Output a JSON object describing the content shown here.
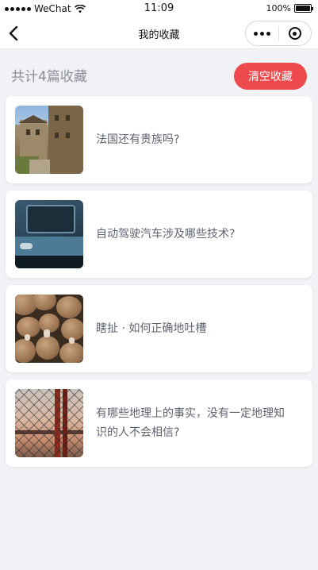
{
  "status_bar": {
    "carrier": "WeChat",
    "time": "11:09",
    "battery": "100%"
  },
  "nav": {
    "title": "我的收藏"
  },
  "header": {
    "count_text": "共计4篇收藏",
    "clear_button": "清空收藏"
  },
  "favorites": [
    {
      "title": "法国还有贵族吗?",
      "thumbnail": "street-houses-photo"
    },
    {
      "title": "自动驾驶汽车涉及哪些技术?",
      "thumbnail": "blue-car-photo"
    },
    {
      "title": "瞎扯 · 如何正确地吐槽",
      "thumbnail": "mushrooms-photo"
    },
    {
      "title": "有哪些地理上的事实，没有一定地理知识的人不会相信?",
      "thumbnail": "bridge-fence-photo"
    }
  ],
  "colors": {
    "accent": "#ee4a4d",
    "background": "#f1f2f5",
    "muted_text": "#8a8f98"
  }
}
